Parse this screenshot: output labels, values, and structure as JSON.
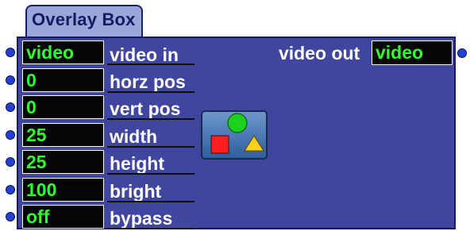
{
  "title": "Overlay Box",
  "inputs": [
    {
      "value": "video",
      "label": "video in"
    },
    {
      "value": "0",
      "label": "horz pos"
    },
    {
      "value": "0",
      "label": "vert pos"
    },
    {
      "value": "25",
      "label": "width"
    },
    {
      "value": "25",
      "label": "height"
    },
    {
      "value": "100",
      "label": "bright"
    },
    {
      "value": "off",
      "label": "bypass"
    }
  ],
  "output": {
    "label": "video out",
    "value": "video"
  },
  "colors": {
    "panel": "#4045a0",
    "tab": "#9aa6d8",
    "value_text": "#2fff2f",
    "port": "#2340d6"
  },
  "icon": {
    "name": "overlay-shapes-icon"
  }
}
